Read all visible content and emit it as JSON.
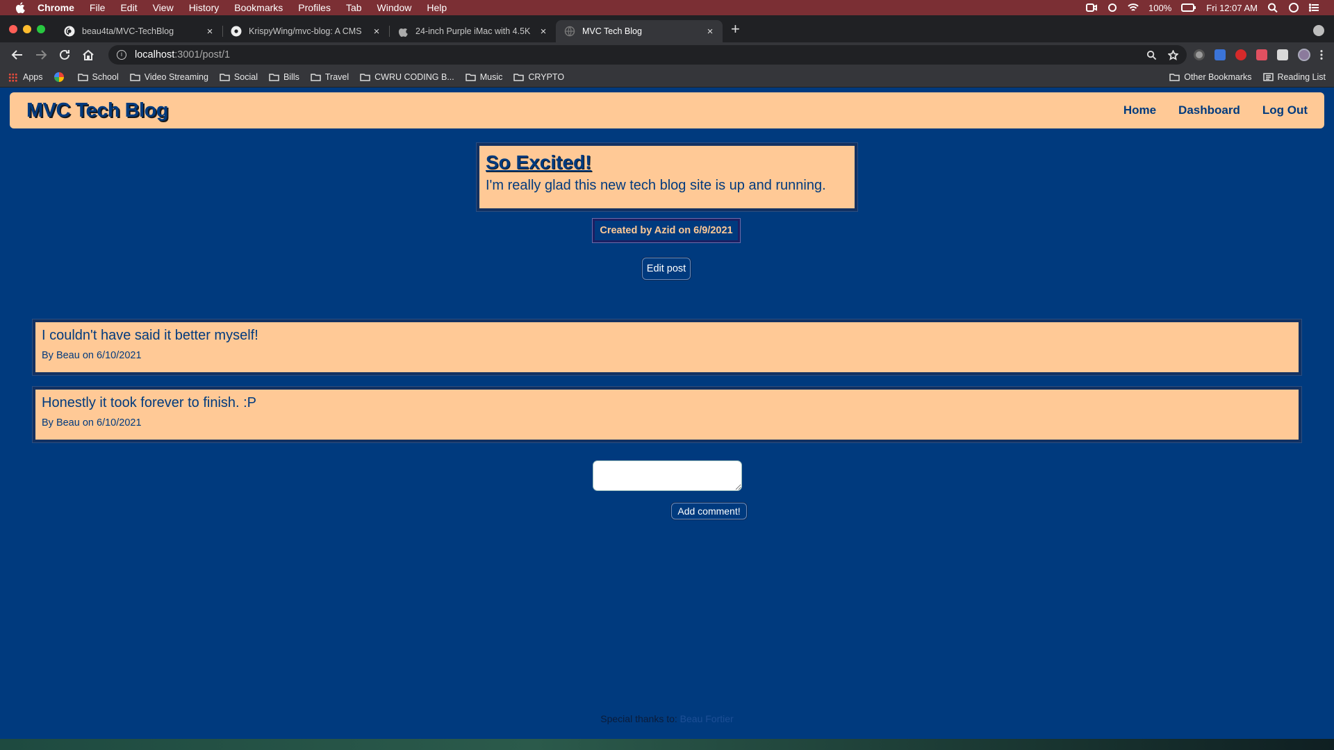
{
  "menubar": {
    "app": "Chrome",
    "items": [
      "File",
      "Edit",
      "View",
      "History",
      "Bookmarks",
      "Profiles",
      "Tab",
      "Window",
      "Help"
    ],
    "battery": "100%",
    "clock": "Fri 12:07 AM"
  },
  "tabs": [
    {
      "title": "beau4ta/MVC-TechBlog",
      "icon": "github-icon"
    },
    {
      "title": "KrispyWing/mvc-blog: A CMS",
      "icon": "github-icon"
    },
    {
      "title": "24-inch Purple iMac with 4.5K",
      "icon": "apple-icon"
    },
    {
      "title": "MVC Tech Blog",
      "icon": "globe-icon",
      "active": true
    }
  ],
  "address": {
    "host": "localhost",
    "rest": ":3001/post/1"
  },
  "bookmarks": {
    "apps": "Apps",
    "items": [
      "School",
      "Video Streaming",
      "Social",
      "Bills",
      "Travel",
      "CWRU CODING B...",
      "Music",
      "CRYPTO"
    ],
    "other": "Other Bookmarks",
    "reading": "Reading List"
  },
  "site": {
    "title": "MVC Tech Blog",
    "nav": {
      "home": "Home",
      "dashboard": "Dashboard",
      "logout": "Log Out"
    }
  },
  "post": {
    "title": "So Excited!",
    "body": "I'm really glad this new tech blog site is up and running.",
    "created": "Created by Azid on 6/9/2021",
    "edit_label": "Edit post"
  },
  "comments": [
    {
      "text": "I couldn't have said it better myself!",
      "meta": "By Beau on 6/10/2021"
    },
    {
      "text": "Honestly it took forever to finish. :P",
      "meta": "By Beau on 6/10/2021"
    }
  ],
  "comment_form": {
    "value": "",
    "submit_label": "Add comment!"
  },
  "footer": {
    "prefix": "Special thanks to:",
    "link": "Beau Fortier"
  },
  "colors": {
    "page_bg": "#003a7e",
    "card_bg": "#ffc996",
    "menubar": "#7b2f34"
  }
}
